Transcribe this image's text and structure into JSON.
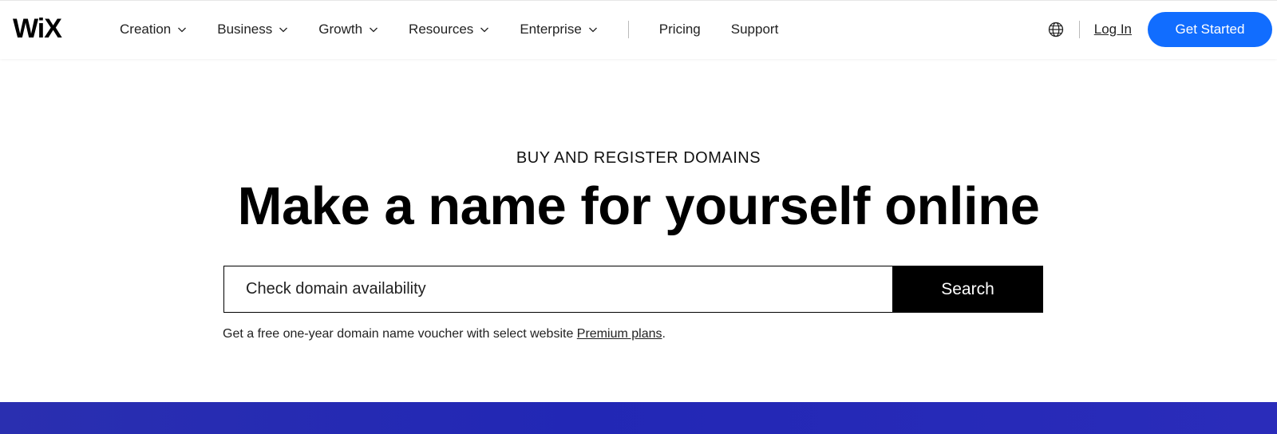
{
  "header": {
    "logo": "WiX",
    "nav": [
      {
        "label": "Creation",
        "has_dropdown": true
      },
      {
        "label": "Business",
        "has_dropdown": true
      },
      {
        "label": "Growth",
        "has_dropdown": true
      },
      {
        "label": "Resources",
        "has_dropdown": true
      },
      {
        "label": "Enterprise",
        "has_dropdown": true
      }
    ],
    "links": [
      "Pricing",
      "Support"
    ],
    "language_icon": "globe-icon",
    "login_label": "Log In",
    "cta_label": "Get Started"
  },
  "hero": {
    "eyebrow": "BUY AND REGISTER DOMAINS",
    "title": "Make a name for yourself online",
    "search": {
      "placeholder": "Check domain availability",
      "value": "",
      "button_label": "Search"
    },
    "voucher_text": "Get a free one-year domain name voucher with select website ",
    "voucher_link": "Premium plans",
    "voucher_suffix": "."
  },
  "colors": {
    "accent": "#116dff",
    "band": "#2227b5",
    "search_button": "#000000"
  }
}
